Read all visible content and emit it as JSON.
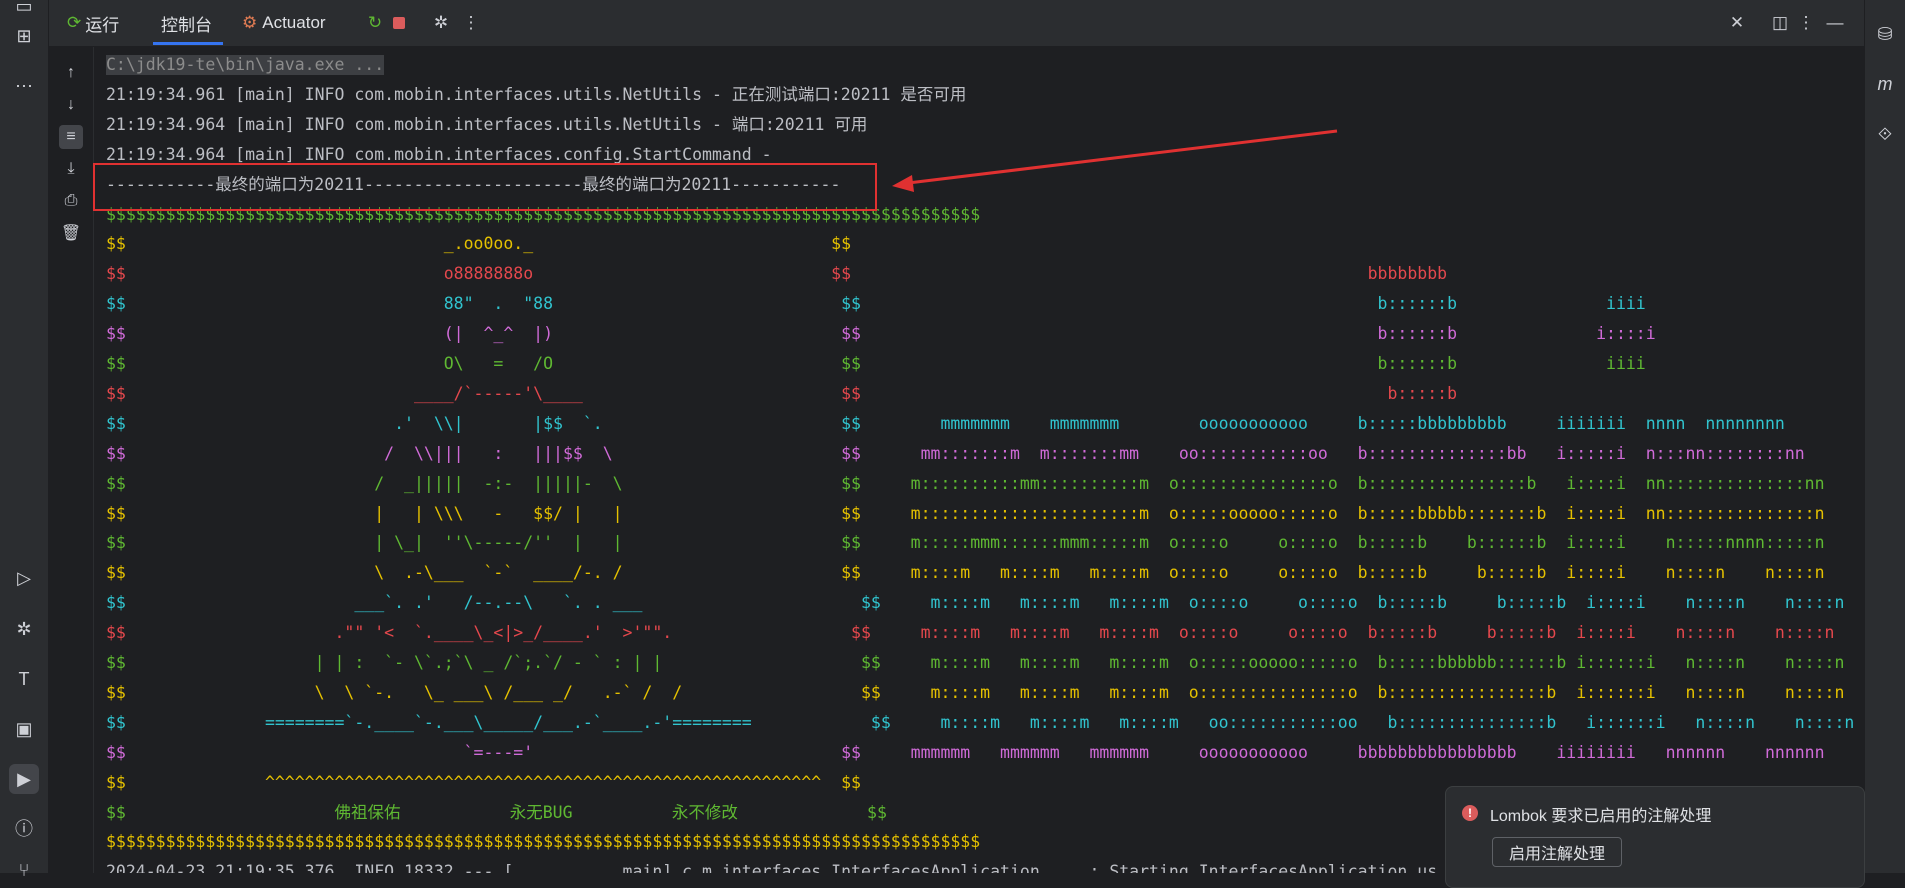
{
  "toolbar": {
    "run_label": "运行",
    "console_label": "控制台",
    "actuator_label": "Actuator"
  },
  "console_lines": [
    {
      "text": "C:\\jdk19-te\\bin\\java.exe ...",
      "color": "#8c8c8c",
      "bg": "#3d3f43"
    },
    {
      "text": "21:19:34.961 [main] INFO com.mobin.interfaces.utils.NetUtils - 正在测试端口:20211 是否可用",
      "color": "#bcbec4"
    },
    {
      "text": "21:19:34.964 [main] INFO com.mobin.interfaces.utils.NetUtils - 端口:20211 可用",
      "color": "#bcbec4"
    },
    {
      "text": "21:19:34.964 [main] INFO com.mobin.interfaces.config.StartCommand -",
      "color": "#bcbec4"
    },
    {
      "text": "-----------最终的端口为20211----------------------最终的端口为20211-----------",
      "color": "#bcbec4"
    },
    {
      "text": "$$$$$$$$$$$$$$$$$$$$$$$$$$$$$$$$$$$$$$$$$$$$$$$$$$$$$$$$$$$$$$$$$$$$$$$$$$$$$$$$$$$$$$$$",
      "color": "#5fb832"
    },
    {
      "text": "$$                                _.oo0oo._                              $$",
      "color": "#e5c100"
    },
    {
      "text": "$$                                o8888888o                              $$                                                    bbbbbbbb",
      "color": "#e5484d"
    },
    {
      "text": "$$                                88\"  .  \"88                             $$                                                    b::::::b               iiii",
      "color": "#31c4cf"
    },
    {
      "text": "$$                                (|  ^_^  |)                             $$                                                    b::::::b              i::::i",
      "color": "#d06bd8"
    },
    {
      "text": "$$                                O\\   =   /O                             $$                                                    b::::::b               iiii",
      "color": "#5fb832"
    },
    {
      "text": "$$                             ____/`-----'\\____                          $$                                                     b:::::b",
      "color": "#e5484d"
    },
    {
      "text": "$$                           .'  \\\\|       |$$  `.                        $$        mmmmmmm    mmmmmmm        ooooooooooo     b:::::bbbbbbbbb     iiiiiii  nnnn  nnnnnnnn",
      "color": "#31c4cf"
    },
    {
      "text": "$$                          /  \\\\|||   :   |||$$  \\                       $$      mm:::::::m  m:::::::mm    oo:::::::::::oo   b::::::::::::::bb   i:::::i  n:::nn::::::::nn",
      "color": "#d06bd8"
    },
    {
      "text": "$$                         /  _|||||  -:-  |||||-  \\                      $$     m::::::::::mm::::::::::m  o:::::::::::::::o  b::::::::::::::::b   i::::i  nn::::::::::::::nn",
      "color": "#5fb832"
    },
    {
      "text": "$$                         |   | \\\\\\   -   $$/ |   |                      $$     m::::::::::::::::::::::m  o:::::ooooo:::::o  b:::::bbbbb:::::::b  i::::i  nn:::::::::::::::n",
      "color": "#e5c100"
    },
    {
      "text": "$$                         | \\_|  ''\\-----/''  |   |                      $$     m:::::mmm::::::mmm:::::m  o::::o     o::::o  b:::::b    b::::::b  i::::i    n:::::nnnn:::::n",
      "color": "#5fb832"
    },
    {
      "text": "$$                         \\  .-\\___  `-`  ____/-. /                      $$     m::::m   m::::m   m::::m  o::::o     o::::o  b:::::b     b:::::b  i::::i    n::::n    n::::n",
      "color": "#e5c100"
    },
    {
      "text": "$$                       ___`. .'   /--.--\\   `. . ___                      $$     m::::m   m::::m   m::::m  o::::o     o::::o  b:::::b     b:::::b  i::::i    n::::n    n::::n",
      "color": "#31c4cf"
    },
    {
      "text": "$$                     .\"\" '<  `.____\\_<|>_/____.'  >'\"\".                  $$     m::::m   m::::m   m::::m  o::::o     o::::o  b:::::b     b:::::b  i::::i    n::::n    n::::n",
      "color": "#e5484d"
    },
    {
      "text": "$$                   | | :  `- \\`.;`\\ _ /`;.`/ - ` : | |                    $$     m::::m   m::::m   m::::m  o:::::ooooo:::::o  b:::::bbbbbb::::::b i::::::i   n::::n    n::::n",
      "color": "#5fb832"
    },
    {
      "text": "$$                   \\  \\ `-.   \\_ ___\\ /___ _/   .-` /  /                  $$     m::::m   m::::m   m::::m  o:::::::::::::::o  b::::::::::::::::b  i::::::i   n::::n    n::::n",
      "color": "#e5c100"
    },
    {
      "text": "$$              ========`-.____`-.___\\_____/___.-`____.-'========            $$     m::::m   m::::m   m::::m   oo:::::::::::oo   b:::::::::::::::b   i::::::i   n::::n    n::::n",
      "color": "#31c4cf"
    },
    {
      "text": "$$                                  `=---='                               $$     mmmmmm   mmmmmm   mmmmmm     ooooooooooo     bbbbbbbbbbbbbbbb    iiiiiiii   nnnnnn    nnnnnn",
      "color": "#d06bd8"
    },
    {
      "text": "$$              ^^^^^^^^^^^^^^^^^^^^^^^^^^^^^^^^^^^^^^^^^^^^^^^^^^^^^^^^  $$",
      "color": "#e5c100"
    },
    {
      "text": "$$                     佛祖保佑           永无BUG          永不修改             $$",
      "color": "#5fb832"
    },
    {
      "text": "$$$$$$$$$$$$$$$$$$$$$$$$$$$$$$$$$$$$$$$$$$$$$$$$$$$$$$$$$$$$$$$$$$$$$$$$$$$$$$$$$$$$$$$$",
      "color": "#e5c100"
    },
    {
      "text": "2024-04-23 21:19:35.376  INFO 18332 --- [           main] c.m.interfaces.InterfacesApplication     : Starting InterfacesApplication us",
      "color": "#bcbec4"
    }
  ],
  "notification": {
    "message": "Lombok 要求已启用的注解处理",
    "button_label": "启用注解处理"
  }
}
